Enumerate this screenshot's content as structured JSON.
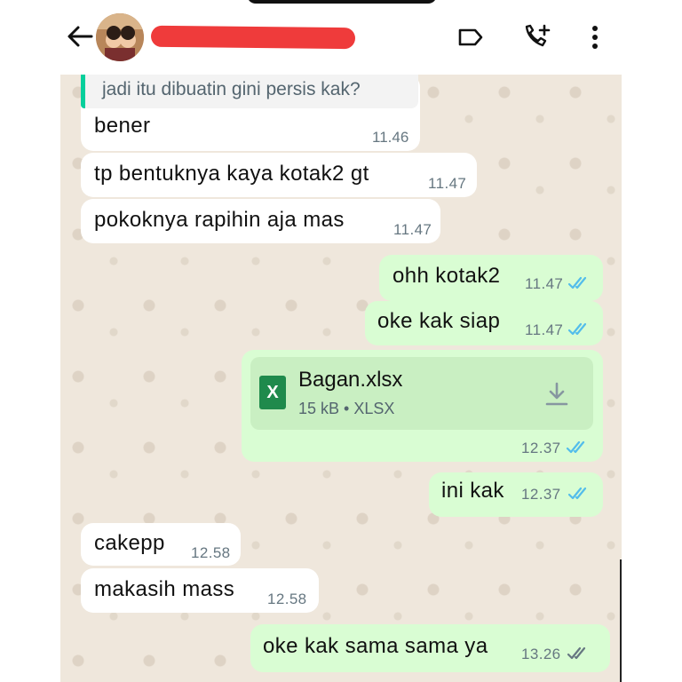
{
  "header": {
    "icons": {
      "back": "arrow-left-icon",
      "label": "label-tag-icon",
      "call": "add-call-icon",
      "menu": "more-vertical-icon"
    }
  },
  "messages": [
    {
      "dir": "in",
      "quote": "jadi itu dibuatin gini persis kak?",
      "text": "bener",
      "time": "11.46"
    },
    {
      "dir": "in",
      "text": "tp bentuknya kaya kotak2 gt",
      "time": "11.47"
    },
    {
      "dir": "in",
      "text": "pokoknya rapihin aja mas",
      "time": "11.47"
    },
    {
      "dir": "out",
      "text": "ohh kotak2",
      "time": "11.47",
      "read": true
    },
    {
      "dir": "out",
      "text": "oke kak siap",
      "time": "11.47",
      "read": true
    },
    {
      "dir": "out",
      "type": "document",
      "file_name": "Bagan.xlsx",
      "file_meta": "15 kB • XLSX",
      "file_icon_letter": "X",
      "time": "12.37",
      "read": true
    },
    {
      "dir": "out",
      "text": "ini kak",
      "time": "12.37",
      "read": true
    },
    {
      "dir": "in",
      "text": "cakepp",
      "time": "12.58"
    },
    {
      "dir": "in",
      "text": "makasih mass",
      "time": "12.58"
    },
    {
      "dir": "out",
      "text": "oke kak sama sama ya",
      "time": "13.26",
      "read": false
    }
  ],
  "colors": {
    "incoming_bubble": "#ffffff",
    "outgoing_bubble": "#d9fdd3",
    "chat_bg": "#efe7dc",
    "read_ticks": "#53bdeb",
    "delivered_ticks": "#667781",
    "redaction": "#ef3b3b"
  }
}
